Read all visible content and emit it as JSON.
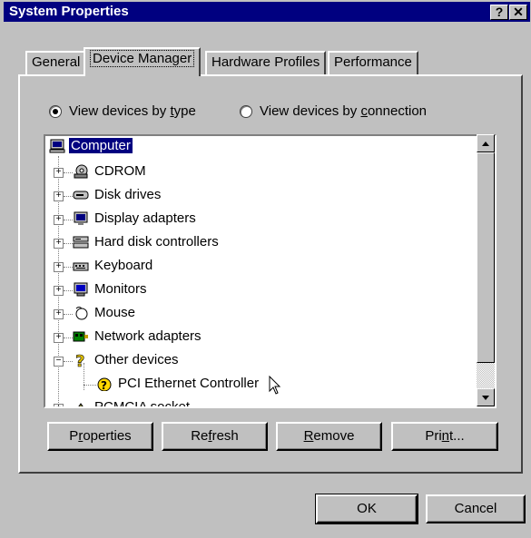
{
  "window": {
    "title": "System Properties",
    "help_btn": "?",
    "close_btn": "✕"
  },
  "tabs": [
    {
      "label": "General"
    },
    {
      "label": "Device Manager"
    },
    {
      "label": "Hardware Profiles"
    },
    {
      "label": "Performance"
    }
  ],
  "view": {
    "by_type_pre": "View devices by ",
    "by_type_u": "t",
    "by_type_post": "ype",
    "by_conn_pre": "View devices by ",
    "by_conn_u": "c",
    "by_conn_post": "onnection",
    "selected": "by_type"
  },
  "tree": {
    "root": "Computer",
    "items": [
      {
        "label": "CDROM",
        "icon": "cdrom-icon"
      },
      {
        "label": "Disk drives",
        "icon": "disk-drive-icon"
      },
      {
        "label": "Display adapters",
        "icon": "display-adapter-icon"
      },
      {
        "label": "Hard disk controllers",
        "icon": "hard-disk-controller-icon"
      },
      {
        "label": "Keyboard",
        "icon": "keyboard-icon"
      },
      {
        "label": "Monitors",
        "icon": "monitor-icon"
      },
      {
        "label": "Mouse",
        "icon": "mouse-icon"
      },
      {
        "label": "Network adapters",
        "icon": "network-adapter-icon"
      },
      {
        "label": "Other devices",
        "icon": "question-icon"
      }
    ],
    "child": "PCI Ethernet Controller",
    "partial": "PCMCIA socket"
  },
  "buttons": {
    "properties_pre": "P",
    "properties_u": "r",
    "properties_post": "operties",
    "refresh_pre": "Re",
    "refresh_u": "f",
    "refresh_post": "resh",
    "remove_pre": "",
    "remove_u": "R",
    "remove_post": "emove",
    "print_pre": "Pri",
    "print_u": "n",
    "print_post": "t...",
    "ok": "OK",
    "cancel": "Cancel"
  },
  "colors": {
    "titlebar": "#000080",
    "selection": "#000080",
    "face": "#c0c0c0"
  }
}
